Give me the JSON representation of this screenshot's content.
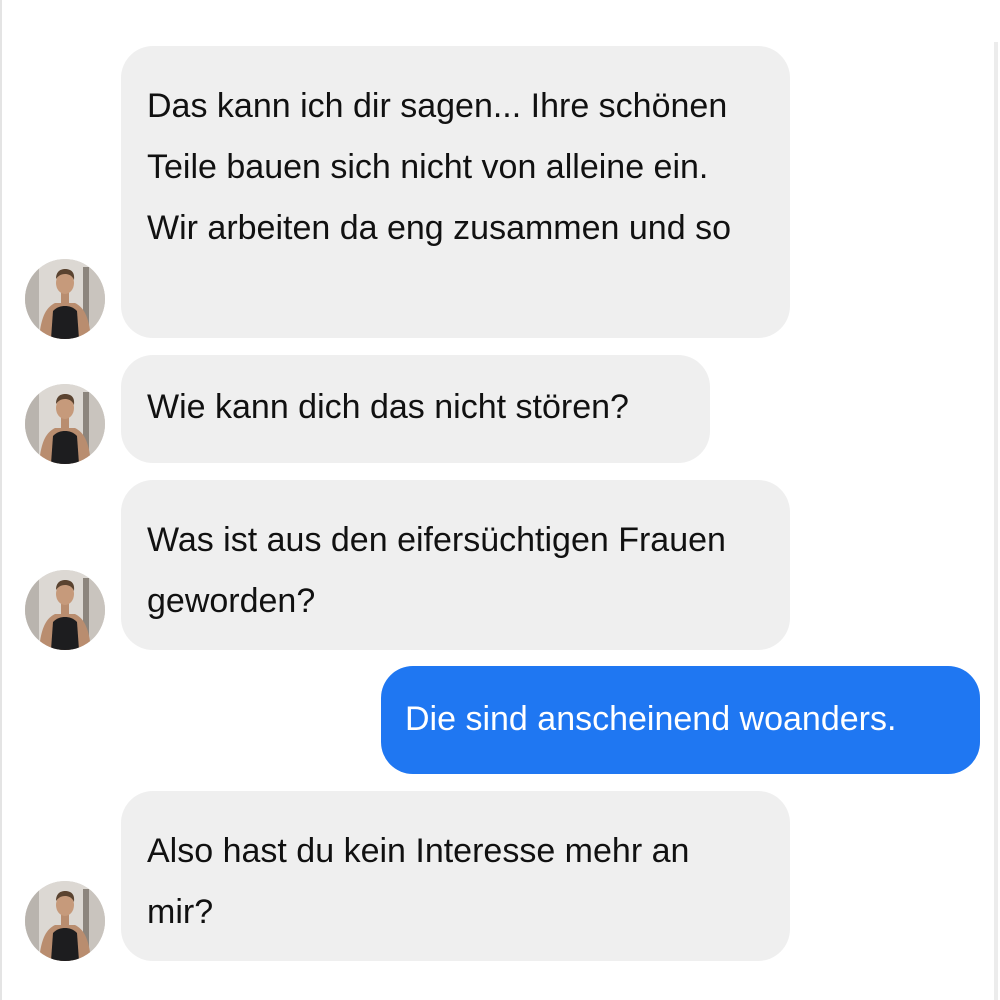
{
  "contact": {
    "avatar_icon": "profile-photo-icon"
  },
  "messages": [
    {
      "direction": "received",
      "text": "Das kann ich dir sagen... Ihre schönen Teile bauen sich nicht von alleine ein. Wir arbeiten da eng zusammen und so"
    },
    {
      "direction": "received",
      "text": "Wie kann dich das nicht stören?"
    },
    {
      "direction": "received",
      "text": "Was ist aus den eifersüchtigen Frauen geworden?"
    },
    {
      "direction": "sent",
      "text": "Die sind anscheinend woanders."
    },
    {
      "direction": "received",
      "text": "Also hast du kein Interesse mehr an mir?"
    }
  ],
  "colors": {
    "received_bubble": "#efefef",
    "sent_bubble": "#1f77f2",
    "received_text": "#111111",
    "sent_text": "#ffffff",
    "background": "#ffffff"
  }
}
